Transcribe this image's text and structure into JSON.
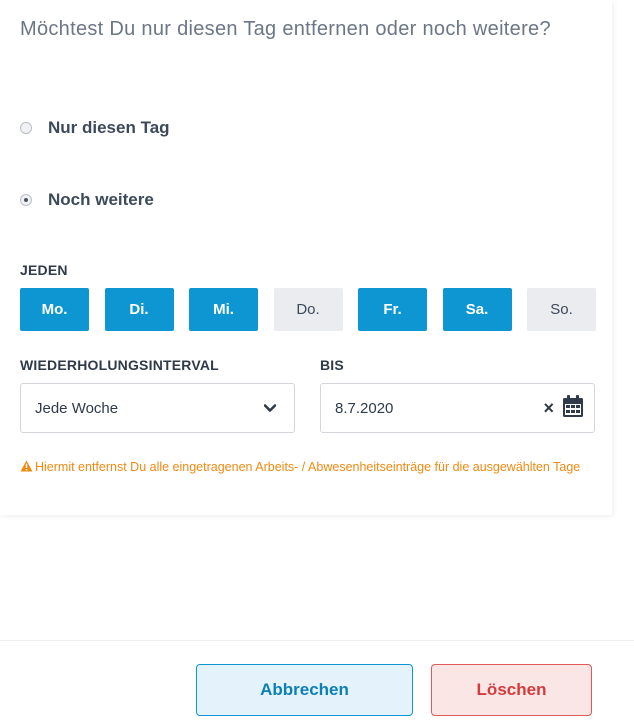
{
  "dialog": {
    "question": "Möchtest Du nur diesen Tag entfernen oder noch weitere?",
    "options": [
      {
        "label": "Nur diesen Tag",
        "checked": false
      },
      {
        "label": "Noch weitere",
        "checked": true
      }
    ]
  },
  "days_section": {
    "label": "JEDEN",
    "days": [
      {
        "label": "Mo.",
        "selected": true
      },
      {
        "label": "Di.",
        "selected": true
      },
      {
        "label": "Mi.",
        "selected": true
      },
      {
        "label": "Do.",
        "selected": false
      },
      {
        "label": "Fr.",
        "selected": true
      },
      {
        "label": "Sa.",
        "selected": true
      },
      {
        "label": "So.",
        "selected": false
      }
    ]
  },
  "interval": {
    "label": "WIEDERHOLUNGSINTERVAL",
    "value": "Jede Woche"
  },
  "until": {
    "label": "BIS",
    "value": "8.7.2020",
    "clear_glyph": "×"
  },
  "warning": {
    "text": "Hiermit entfernst Du alle eingetragenen Arbeits- / Abwesenheitseinträge für die ausgewählten Tage",
    "color": "#f08a12"
  },
  "footer": {
    "cancel_label": "Abbrechen",
    "delete_label": "Löschen"
  },
  "colors": {
    "accent": "#0e96d2",
    "danger": "#e05a5a"
  },
  "icons": {
    "interval_dropdown": "chevron-down-icon",
    "until_calendar": "calendar-icon",
    "warning": "warning-triangle-icon"
  }
}
